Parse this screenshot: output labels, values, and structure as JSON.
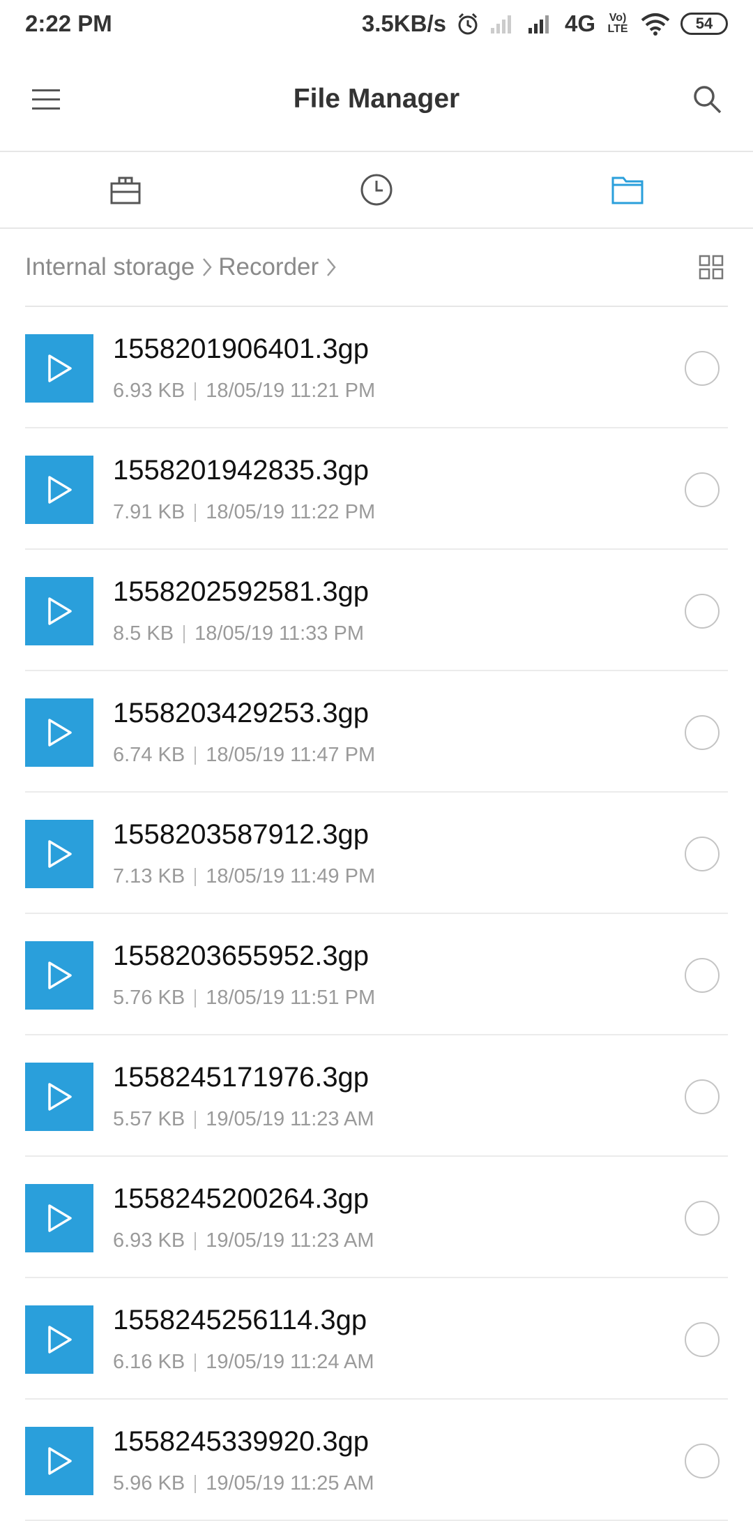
{
  "status": {
    "time": "2:22 PM",
    "speed": "3.5KB/s",
    "network": "4G",
    "volte": "Vo) LTE",
    "battery": "54"
  },
  "header": {
    "title": "File Manager"
  },
  "breadcrumb": {
    "root": "Internal storage",
    "folder": "Recorder"
  },
  "colors": {
    "accent": "#2a9fdb"
  },
  "files": [
    {
      "name": "1558201906401.3gp",
      "size": "6.93 KB",
      "date": "18/05/19 11:21 PM"
    },
    {
      "name": "1558201942835.3gp",
      "size": "7.91 KB",
      "date": "18/05/19 11:22 PM"
    },
    {
      "name": "1558202592581.3gp",
      "size": "8.5 KB",
      "date": "18/05/19 11:33 PM"
    },
    {
      "name": "1558203429253.3gp",
      "size": "6.74 KB",
      "date": "18/05/19 11:47 PM"
    },
    {
      "name": "1558203587912.3gp",
      "size": "7.13 KB",
      "date": "18/05/19 11:49 PM"
    },
    {
      "name": "1558203655952.3gp",
      "size": "5.76 KB",
      "date": "18/05/19 11:51 PM"
    },
    {
      "name": "1558245171976.3gp",
      "size": "5.57 KB",
      "date": "19/05/19 11:23 AM"
    },
    {
      "name": "1558245200264.3gp",
      "size": "6.93 KB",
      "date": "19/05/19 11:23 AM"
    },
    {
      "name": "1558245256114.3gp",
      "size": "6.16 KB",
      "date": "19/05/19 11:24 AM"
    },
    {
      "name": "1558245339920.3gp",
      "size": "5.96 KB",
      "date": "19/05/19 11:25 AM"
    }
  ]
}
